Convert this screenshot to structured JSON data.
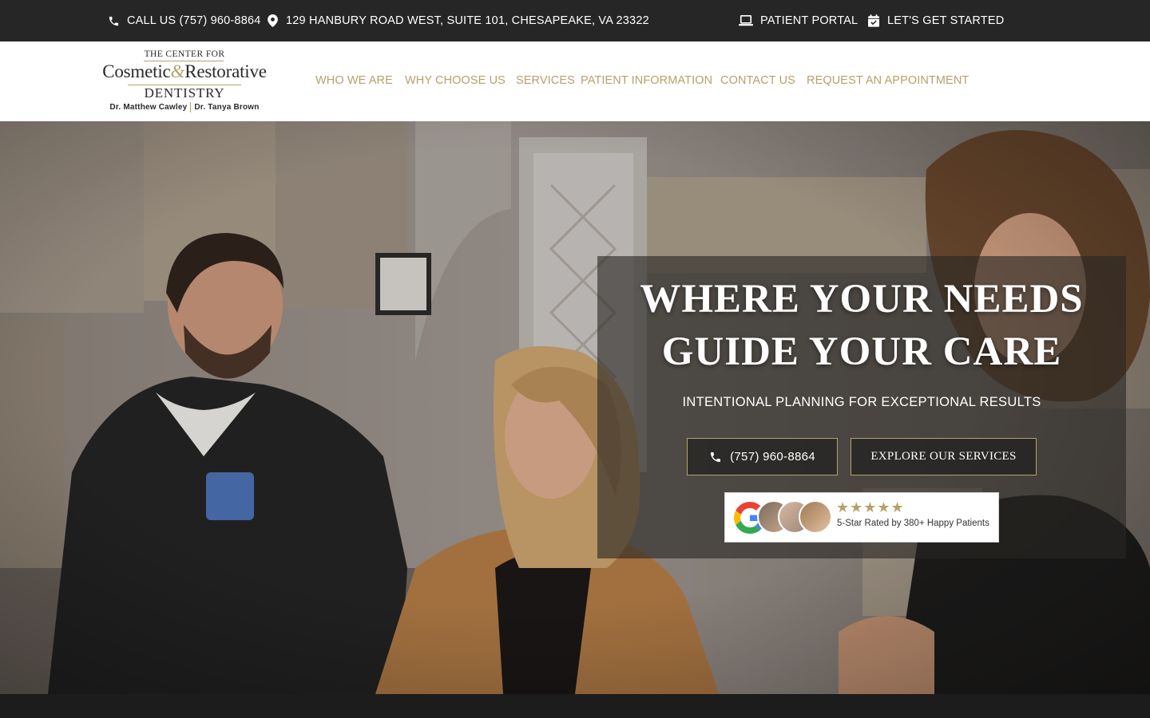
{
  "topbar": {
    "call": "CALL US (757) 960-8864",
    "address": "129 HANBURY ROAD WEST, SUITE 101, CHESAPEAKE, VA 23322",
    "portal": "PATIENT PORTAL",
    "get_started": "LET'S GET STARTED"
  },
  "logo": {
    "top": "THE CENTER FOR",
    "main_left": "Cosmetic",
    "main_amp": "&",
    "main_right": "Restorative",
    "sub": "DENTISTRY",
    "doctor1": "Dr. Matthew Cawley",
    "doctor2": "Dr. Tanya Brown"
  },
  "nav": {
    "items": [
      {
        "label": "WHO WE ARE"
      },
      {
        "label": "WHY CHOOSE US"
      },
      {
        "label": "SERVICES"
      },
      {
        "label": "PATIENT INFORMATION"
      },
      {
        "label": "CONTACT US"
      },
      {
        "label": "REQUEST AN APPOINTMENT"
      }
    ]
  },
  "hero": {
    "title_line1": "WHERE YOUR NEEDS",
    "title_line2": "GUIDE YOUR CARE",
    "subtitle": "INTENTIONAL PLANNING FOR EXCEPTIONAL RESULTS",
    "phone_button": "(757) 960-8864",
    "services_button": "EXPLORE OUR SERVICES",
    "review_stars": "★★★★★",
    "review_text": "5-Star Rated by 380+ Happy Patients",
    "rating": 5
  },
  "colors": {
    "gold": "#b4a26a",
    "topbar_bg": "#262626",
    "header_bg": "#ffffff",
    "overlay": "rgba(40,38,36,0.62)"
  },
  "icons": {
    "call": "phone-icon",
    "address": "map-pin-icon",
    "portal": "laptop-icon",
    "get_started": "calendar-check-icon",
    "review": "google-icon"
  }
}
